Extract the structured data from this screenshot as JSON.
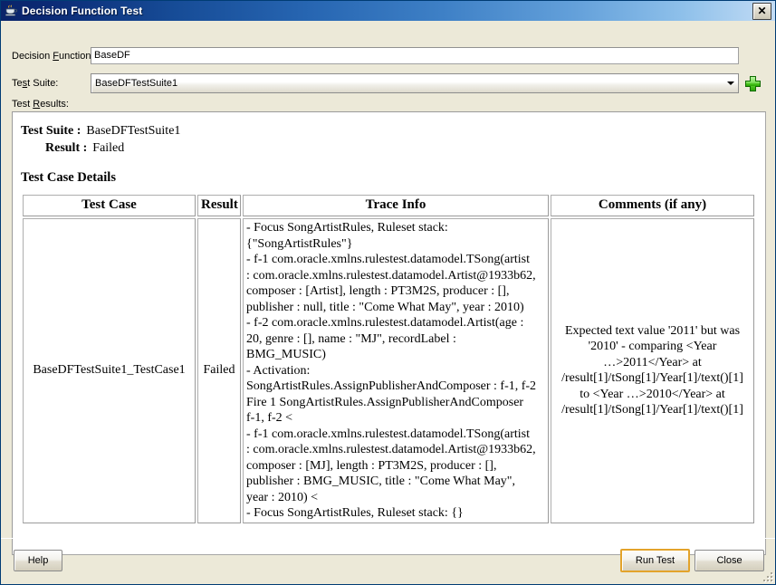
{
  "window": {
    "title": "Decision Function Test",
    "icon": "java-coffee-cup-icon",
    "close_label": "✕"
  },
  "form": {
    "decision_function": {
      "label_pre": "Decision ",
      "label_mnemonic": "F",
      "label_post": "unction:",
      "value": "BaseDF"
    },
    "test_suite": {
      "label_pre": "Te",
      "label_mnemonic": "s",
      "label_post": "t Suite:",
      "value": "BaseDFTestSuite1",
      "add_icon": "green-plus-icon"
    },
    "test_results": {
      "label_pre": "Test ",
      "label_mnemonic": "R",
      "label_post": "esults:"
    }
  },
  "results": {
    "suite_key": "Test Suite :",
    "suite_value": "BaseDFTestSuite1",
    "result_key": "Result :",
    "result_value": "Failed",
    "details_heading": "Test Case Details",
    "table": {
      "headers": [
        "Test Case",
        "Result",
        "Trace Info",
        "Comments (if any)"
      ],
      "rows": [
        {
          "test_case": "BaseDFTestSuite1_TestCase1",
          "result": "Failed",
          "trace_lines": [
            "- Focus SongArtistRules, Ruleset stack:",
            "{\"SongArtistRules\"}",
            "- f-1 com.oracle.xmlns.rulestest.datamodel.TSong(artist",
            ": com.oracle.xmlns.rulestest.datamodel.Artist@1933b62,",
            "composer : [Artist], length : PT3M2S, producer : [],",
            "publisher : null, title : \"Come What May\", year : 2010)",
            "- f-2 com.oracle.xmlns.rulestest.datamodel.Artist(age :",
            "20, genre : [], name : \"MJ\", recordLabel :",
            "BMG_MUSIC)",
            "- Activation:",
            "SongArtistRules.AssignPublisherAndComposer : f-1, f-2",
            "Fire 1 SongArtistRules.AssignPublisherAndComposer",
            "f-1, f-2 <",
            "- f-1 com.oracle.xmlns.rulestest.datamodel.TSong(artist",
            ": com.oracle.xmlns.rulestest.datamodel.Artist@1933b62,",
            "composer : [MJ], length : PT3M2S, producer : [],",
            "publisher : BMG_MUSIC, title : \"Come What May\",",
            "year : 2010) <",
            "- Focus SongArtistRules, Ruleset stack: {}"
          ],
          "comment_lines": [
            "Expected text value '2011' but was",
            "'2010' - comparing <Year",
            "…>2011</Year> at",
            "/result[1]/tSong[1]/Year[1]/text()[1]",
            "to <Year …>2010</Year> at",
            "/result[1]/tSong[1]/Year[1]/text()[1]"
          ]
        }
      ]
    }
  },
  "buttons": {
    "help": "Help",
    "run_test": "Run Test",
    "close": "Close"
  },
  "colors": {
    "title_start": "#0a246a",
    "title_end": "#c3dcf5",
    "dialog_bg": "#ece9d8",
    "focus_border": "#e3a32b",
    "plus_green": "#2a9c05"
  }
}
